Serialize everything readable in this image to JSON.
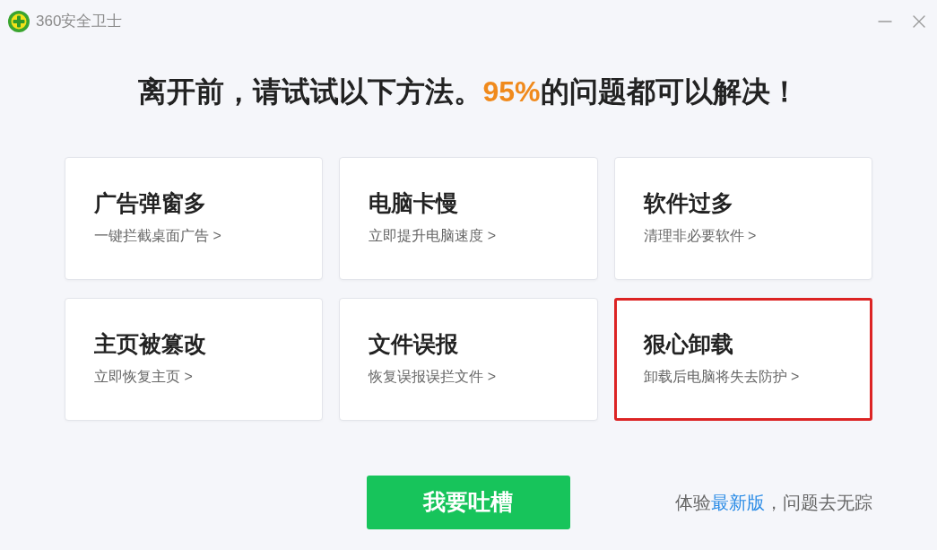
{
  "window": {
    "title": "360安全卫士"
  },
  "heading": "离开前，请试试以下方法。**95%**的问题都可以解决！",
  "options": [
    {
      "title": "广告弹窗多",
      "link": "一键拦截桌面广告 >",
      "highlighted": false
    },
    {
      "title": "电脑卡慢",
      "link": "立即提升电脑速度 >",
      "highlighted": false
    },
    {
      "title": "软件过多",
      "link": "清理非必要软件 >",
      "highlighted": false
    },
    {
      "title": "主页被篡改",
      "link": "立即恢复主页 >",
      "highlighted": false
    },
    {
      "title": "文件误报",
      "link": "恢复误报误拦文件 >",
      "highlighted": false
    },
    {
      "title": "狠心卸载",
      "link": "卸载后电脑将失去防护 >",
      "highlighted": true
    }
  ],
  "feedback_button": "我要吐槽",
  "upgrade_hint": {
    "before": "体验",
    "link": "最新版",
    "after": "，问题去无踪"
  }
}
